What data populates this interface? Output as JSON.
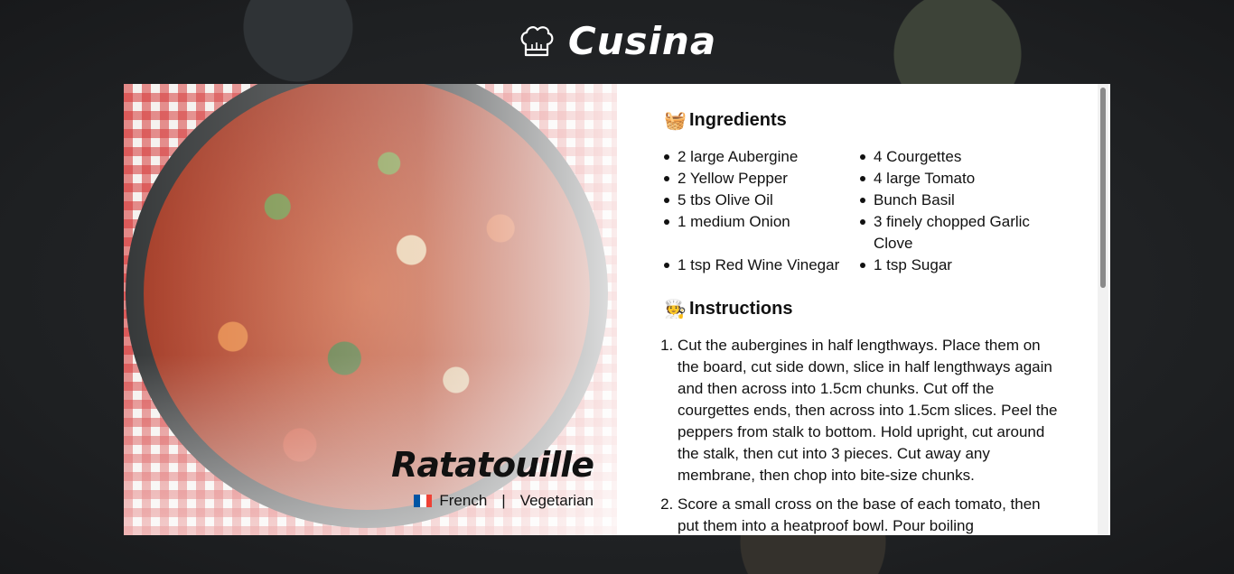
{
  "app": {
    "name": "Cusina",
    "logo_icon": "chef-hat-icon"
  },
  "recipe": {
    "title": "Ratatouille",
    "cuisine": "French",
    "category": "Vegetarian",
    "separator": "|",
    "flag_colors": [
      "#0055a4",
      "#ffffff",
      "#ef4135"
    ]
  },
  "ingredients": {
    "heading": "Ingredients",
    "icon": "picnic-basket-icon",
    "items": [
      "2 large Aubergine",
      "4 Courgettes",
      "2 Yellow Pepper",
      "4 large Tomato",
      "5 tbs Olive Oil",
      "Bunch Basil",
      "1 medium Onion",
      "3 finely chopped Garlic Clove",
      "1 tsp Red Wine Vinegar",
      "1 tsp Sugar"
    ]
  },
  "instructions": {
    "heading": "Instructions",
    "icon": "cook-icon",
    "steps": [
      "Cut the aubergines in half lengthways. Place them on the board, cut side down, slice in half lengthways again and then across into 1.5cm chunks. Cut off the courgettes ends, then across into 1.5cm slices. Peel the peppers from stalk to bottom. Hold upright, cut around the stalk, then cut into 3 pieces. Cut away any membrane, then chop into bite-size chunks.",
      "Score a small cross on the base of each tomato, then put them into a heatproof bowl. Pour boiling"
    ]
  },
  "colors": {
    "background": "#1e2022",
    "card": "#ffffff",
    "text": "#111111"
  }
}
